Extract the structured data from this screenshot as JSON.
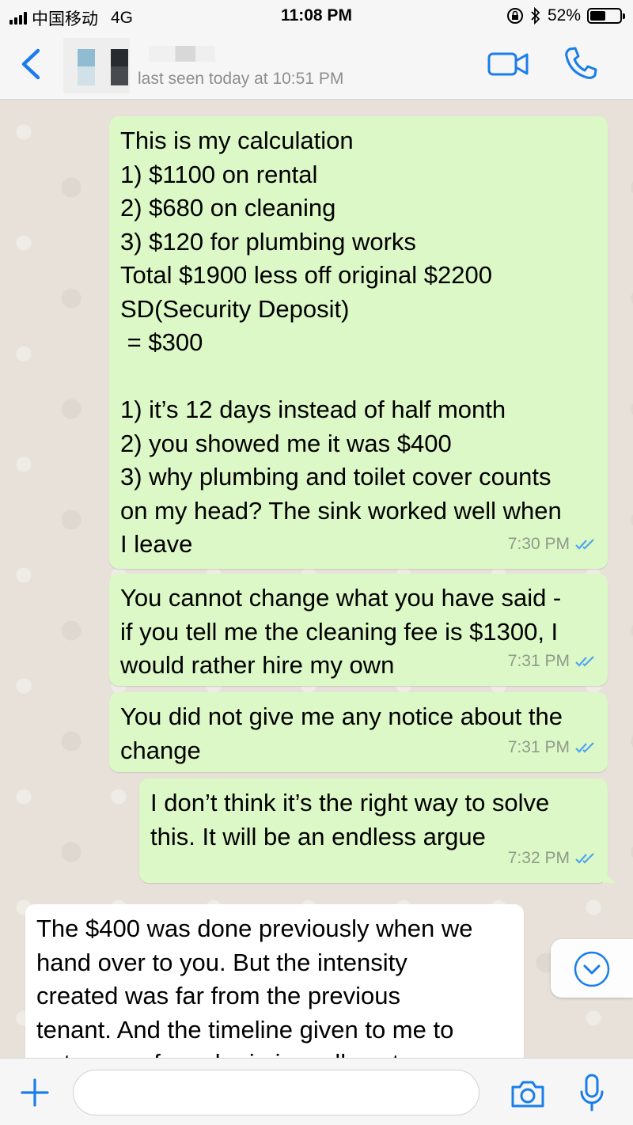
{
  "status_bar": {
    "carrier": "中国移动",
    "network": "4G",
    "time": "11:08 PM",
    "battery": "52%",
    "battery_level": 0.52
  },
  "header": {
    "last_seen": "last seen today at 10:51 PM"
  },
  "messages": [
    {
      "direction": "outgoing",
      "text": "This is my calculation\n1) $1100 on rental\n2) $680 on cleaning\n3) $120 for plumbing works\nTotal $1900 less off original $2200\nSD(Security Deposit)\n = $300\n\n1) it’s 12 days instead of half month\n2) you showed me it was $400\n3) why plumbing and toilet cover counts\non my head? The sink worked well when\nI leave",
      "time": "7:30 PM",
      "status": "read"
    },
    {
      "direction": "outgoing",
      "text": "You cannot change what you have said -\nif you tell me the cleaning fee is $1300, I\nwould rather hire my own",
      "time": "7:31 PM",
      "status": "read"
    },
    {
      "direction": "outgoing",
      "text": "You did not give me any notice about the\nchange",
      "time": "7:31 PM",
      "status": "read"
    },
    {
      "direction": "outgoing",
      "text": "I don’t think it’s the right way to solve\nthis. It will be an endless argue",
      "time": "7:32 PM",
      "status": "read"
    },
    {
      "direction": "incoming",
      "text": "The $400 was done previously when we\nhand over to you. But the intensity\ncreated was far from the previous\ntenant. And the timeline given to me to\nget a grp of vendor in is really not my",
      "time": ""
    }
  ],
  "icons": {
    "back": "chevron-left-icon",
    "video": "video-camera-icon",
    "call": "phone-icon",
    "scroll": "chevron-down-circle-icon",
    "plus": "plus-icon",
    "camera": "camera-icon",
    "mic": "microphone-icon"
  },
  "colors": {
    "accent": "#1a7dea",
    "outgoing_bubble": "#dcf8c6",
    "incoming_bubble": "#ffffff",
    "read_ticks": "#4fa4f0"
  },
  "input": {
    "value": ""
  }
}
